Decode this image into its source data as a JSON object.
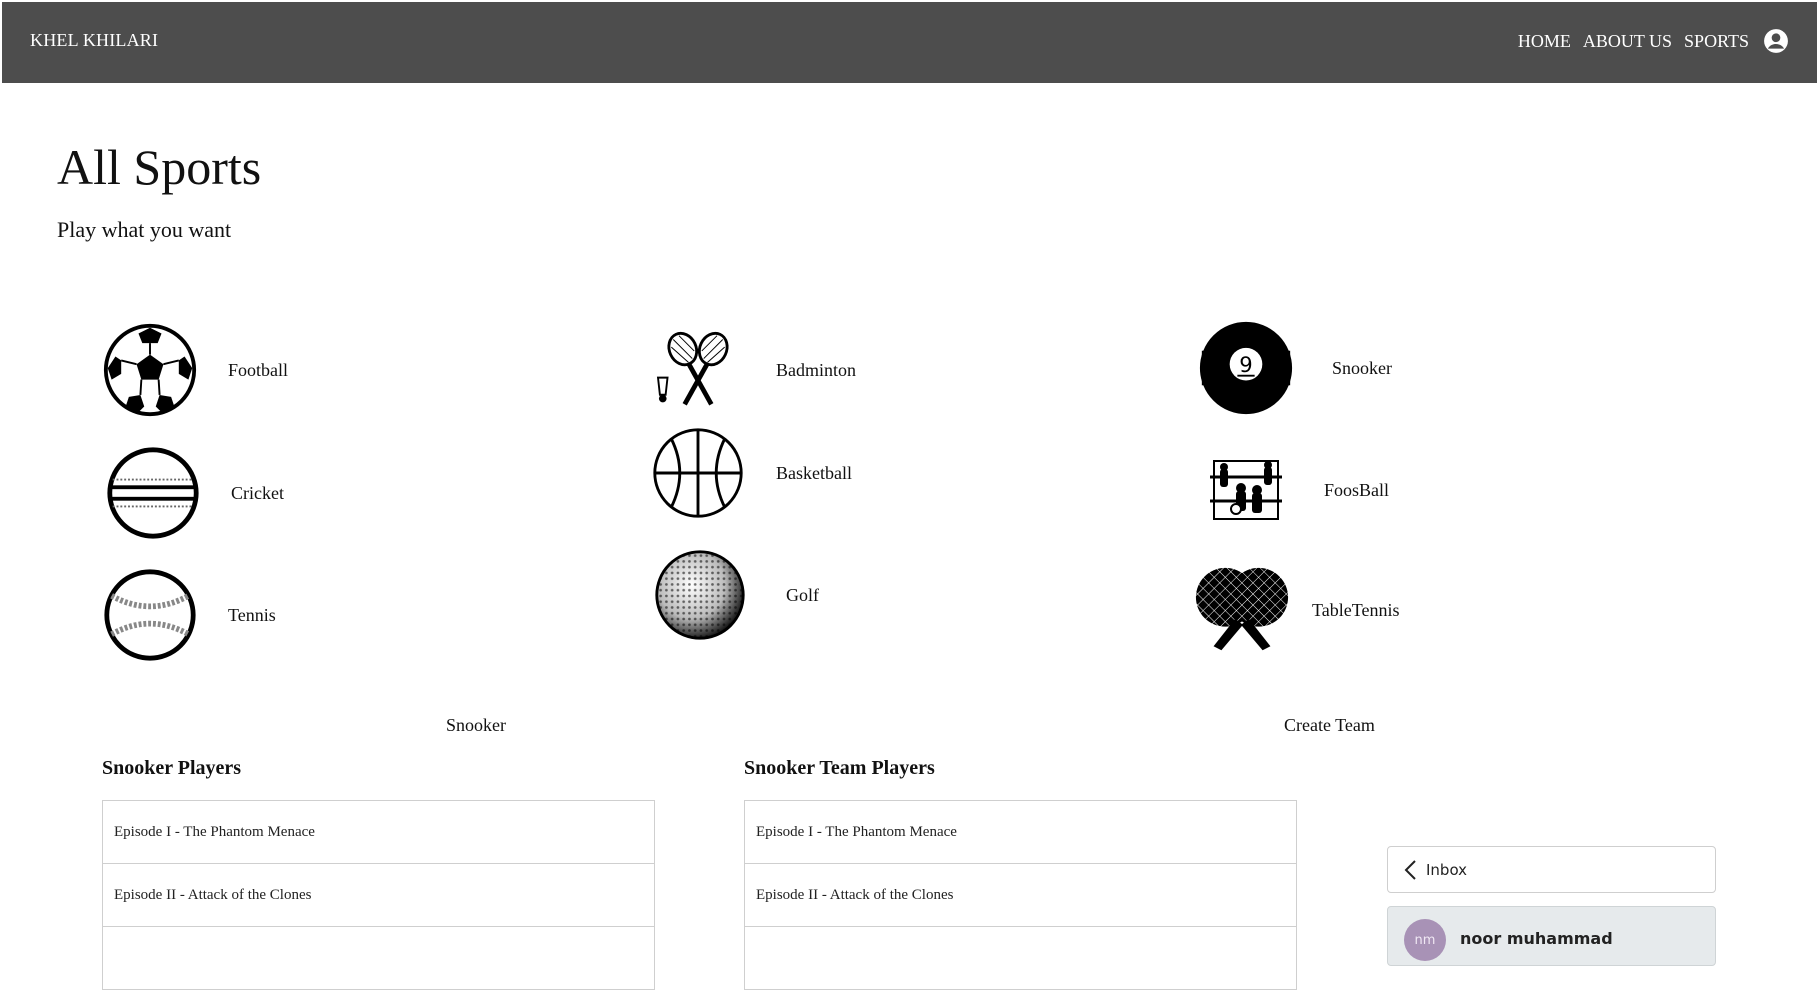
{
  "navbar": {
    "brand": "KHEL KHILARI",
    "links": [
      "HOME",
      "ABOUT US",
      "SPORTS"
    ],
    "user_icon": "account-circle-icon"
  },
  "header": {
    "title": "All Sports",
    "subtitle": "Play what you want"
  },
  "sports": [
    {
      "label": "Football",
      "icon": "football-icon"
    },
    {
      "label": "Cricket",
      "icon": "cricket-ball-icon"
    },
    {
      "label": "Tennis",
      "icon": "tennis-ball-icon"
    },
    {
      "label": "Badminton",
      "icon": "badminton-icon"
    },
    {
      "label": "Basketball",
      "icon": "basketball-icon"
    },
    {
      "label": "Golf",
      "icon": "golf-ball-icon"
    },
    {
      "label": "Snooker",
      "icon": "snooker-ball-icon"
    },
    {
      "label": "FoosBall",
      "icon": "foosball-icon"
    },
    {
      "label": "TableTennis",
      "icon": "table-tennis-icon"
    }
  ],
  "sections": {
    "left_label": "Snooker",
    "right_label": "Create Team"
  },
  "players_list": {
    "title": "Snooker Players",
    "items": [
      "Episode I - The Phantom Menace",
      "Episode II - Attack of the Clones"
    ]
  },
  "team_list": {
    "title": "Snooker Team Players",
    "items": [
      "Episode I - The Phantom Menace",
      "Episode II - Attack of the Clones"
    ]
  },
  "chat": {
    "inbox_label": "Inbox",
    "contact_initials": "nm",
    "contact_name": "noor muhammad"
  }
}
